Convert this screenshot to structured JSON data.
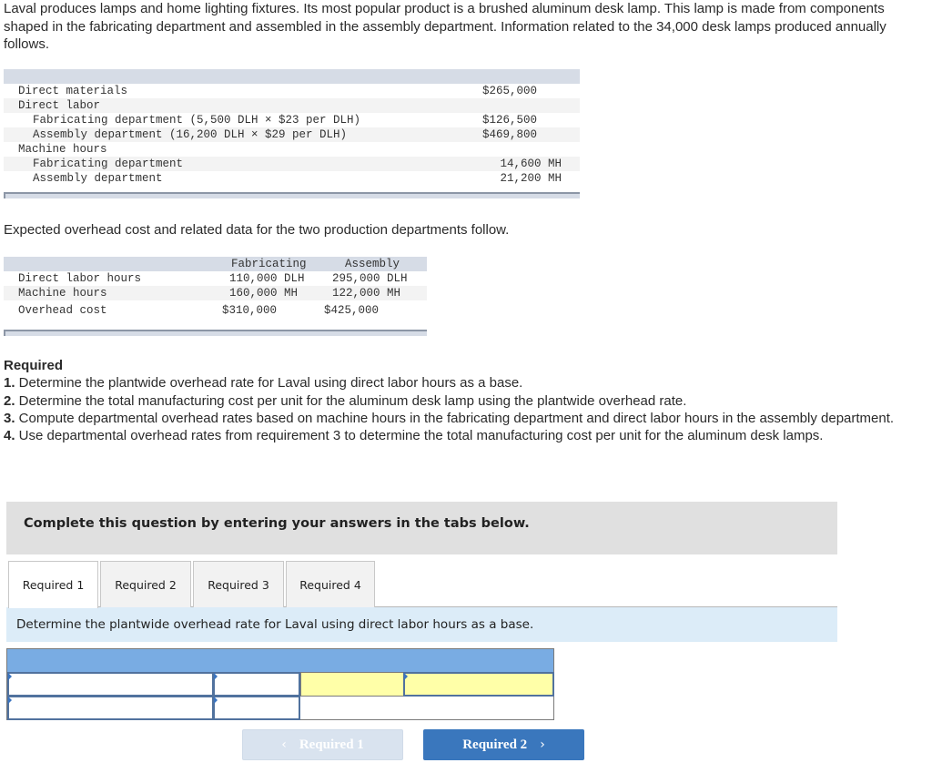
{
  "intro": "Laval produces lamps and home lighting fixtures. Its most popular product is a brushed aluminum desk lamp. This lamp is made from components shaped in the fabricating department and assembled in the assembly department. Information related to the 34,000 desk lamps produced annually follows.",
  "table1": {
    "rows": [
      {
        "label": "Direct materials",
        "value": "$265,000"
      },
      {
        "label": "Direct labor",
        "value": ""
      },
      {
        "label": "Fabricating department (5,500 DLH × $23 per DLH)",
        "value": "$126,500"
      },
      {
        "label": "Assembly department (16,200 DLH × $29 per DLH)",
        "value": "$469,800"
      },
      {
        "label": "Machine hours",
        "value": ""
      },
      {
        "label": "Fabricating department",
        "value": "14,600 MH"
      },
      {
        "label": "Assembly department",
        "value": "21,200 MH"
      }
    ]
  },
  "overhead_intro": "Expected overhead cost and related data for the two production departments follow.",
  "table2": {
    "headers": [
      "",
      "Fabricating",
      "Assembly"
    ],
    "rows": [
      {
        "label": "Direct labor hours",
        "fabricating": "110,000 DLH",
        "assembly": "295,000 DLH"
      },
      {
        "label": "Machine hours",
        "fabricating": "160,000 MH",
        "assembly": "122,000 MH"
      },
      {
        "label": "Overhead cost",
        "fabricating": "$310,000",
        "assembly": "$425,000"
      }
    ]
  },
  "required": {
    "title": "Required",
    "items": [
      {
        "num": "1.",
        "text": " Determine the plantwide overhead rate for Laval using direct labor hours as a base."
      },
      {
        "num": "2.",
        "text": " Determine the total manufacturing cost per unit for the aluminum desk lamp using the plantwide overhead rate."
      },
      {
        "num": "3.",
        "text": " Compute departmental overhead rates based on machine hours in the fabricating department and direct labor hours in the assembly department."
      },
      {
        "num": "4.",
        "text": " Use departmental overhead rates from requirement 3 to determine the total manufacturing cost per unit for the aluminum desk lamps."
      }
    ]
  },
  "banner": "Complete this question by entering your answers in the tabs below.",
  "tabs": [
    {
      "label": "Required 1",
      "active": true
    },
    {
      "label": "Required 2",
      "active": false
    },
    {
      "label": "Required 3",
      "active": false
    },
    {
      "label": "Required 4",
      "active": false
    }
  ],
  "instruction": "Determine the plantwide overhead rate for Laval using direct labor hours as a base.",
  "answer_grid": {
    "row1": {
      "cell1": "",
      "cell2": "",
      "cell4": ""
    },
    "row2": {
      "cell1": "",
      "cell2": ""
    }
  },
  "nav": {
    "prev_label": "Required 1",
    "next_label": "Required 2",
    "prev_icon": "‹",
    "next_icon": "›"
  },
  "colors": {
    "grid_header": "#79ace3",
    "answer_cell_highlight": "#ffffa8",
    "next_button": "#3a77bd",
    "instruction_bg": "#dcecf8"
  }
}
